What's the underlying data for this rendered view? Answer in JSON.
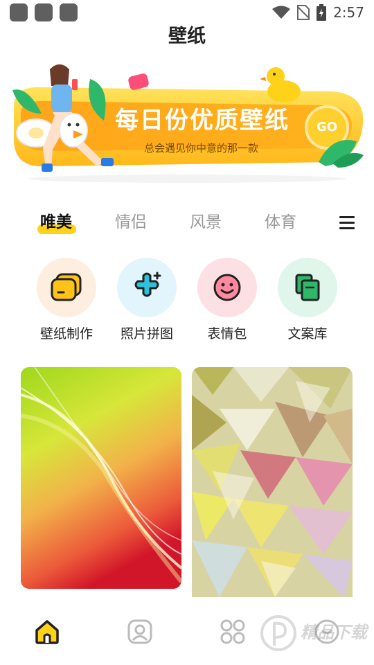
{
  "status_bar": {
    "time": "2:57"
  },
  "header": {
    "title": "壁纸"
  },
  "banner": {
    "title": "每日份优质壁纸",
    "subtitle": "总会遇见你中意的那一款",
    "go_label": "GO"
  },
  "tabs": [
    {
      "label": "唯美",
      "active": true
    },
    {
      "label": "情侣",
      "active": false
    },
    {
      "label": "风景",
      "active": false
    },
    {
      "label": "体育",
      "active": false
    }
  ],
  "tools": [
    {
      "label": "壁纸制作",
      "icon": "wallpaper-make-icon",
      "bg": "#fdeee0"
    },
    {
      "label": "照片拼图",
      "icon": "puzzle-sparkle-icon",
      "bg": "#e2f4fc"
    },
    {
      "label": "表情包",
      "icon": "smiley-icon",
      "bg": "#fde0e4"
    },
    {
      "label": "文案库",
      "icon": "copy-library-icon",
      "bg": "#e0f6ea"
    }
  ],
  "colors": {
    "accent": "#ffd21a",
    "banner_orange": "#ffa21a",
    "inactive_tab": "#999999"
  },
  "bottom_nav": [
    {
      "icon": "home-icon",
      "active": true
    },
    {
      "icon": "profile-card-icon",
      "active": false
    },
    {
      "icon": "grid-apps-icon",
      "active": false
    },
    {
      "icon": "smile-face-icon",
      "active": false
    }
  ],
  "watermark": {
    "text": "精品下载"
  }
}
